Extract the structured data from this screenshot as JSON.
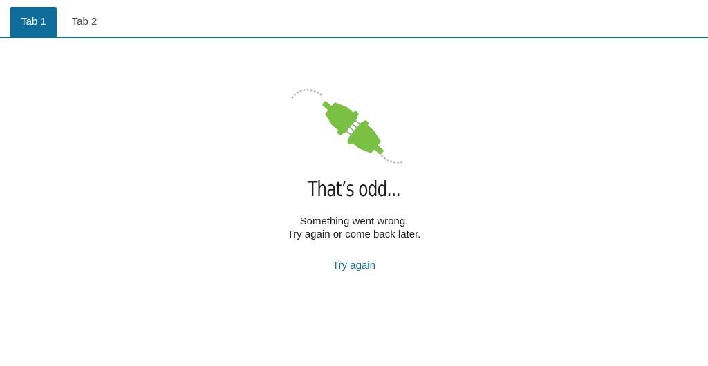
{
  "tabs": [
    {
      "label": "Tab 1",
      "active": true
    },
    {
      "label": "Tab 2",
      "active": false
    }
  ],
  "error": {
    "title": "That’s odd...",
    "line1": "Something went wrong.",
    "line2": "Try again or come back later.",
    "retry_label": "Try again",
    "illustration_icon": "unplugged-plug-icon"
  },
  "colors": {
    "accent": "#0e6d9b",
    "plug_green": "#7ac143",
    "dots_gray": "#b8b8b8"
  }
}
